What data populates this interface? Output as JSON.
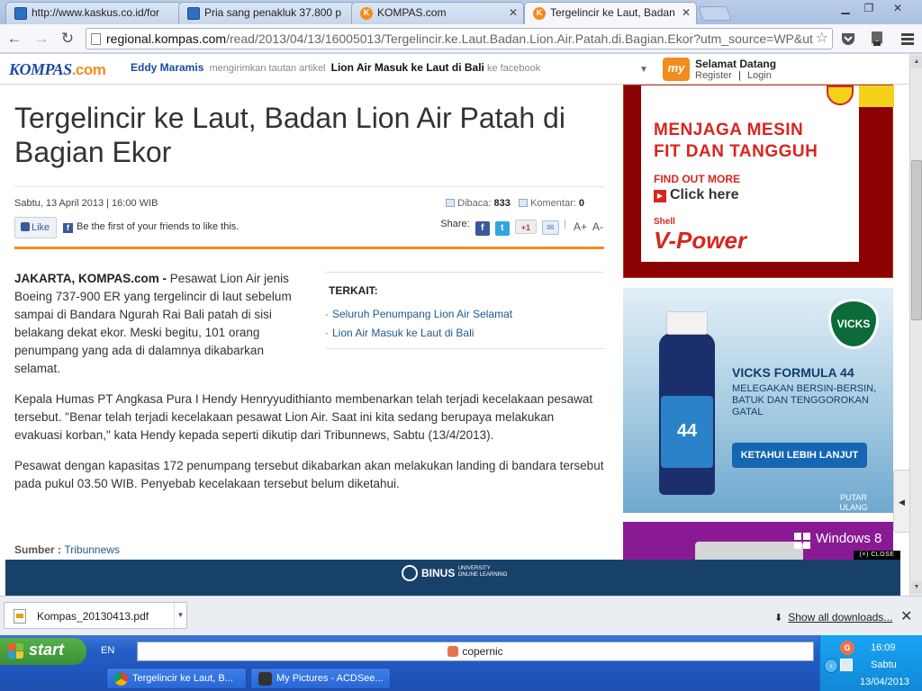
{
  "browser": {
    "tabs": [
      {
        "label": "http://www.kaskus.co.id/for",
        "favicon": "kaskus-favicon"
      },
      {
        "label": "Pria sang penakluk 37.800 p",
        "favicon": "kaskus-favicon"
      },
      {
        "label": "KOMPAS.com",
        "favicon": "kompas-favicon"
      },
      {
        "label": "Tergelincir ke Laut, Badan Lio",
        "favicon": "kompas-favicon"
      }
    ],
    "url_host": "regional.kompas.com",
    "url_path": "/read/2013/04/13/16005013/Tergelincir.ke.Laut.Badan.Lion.Air.Patah.di.Bagian.Ekor?utm_source=WP&ut",
    "accent": "#f28c1e"
  },
  "kompas_bar": {
    "logo": "KOMPAS",
    "logo_suffix": ".com",
    "share_user": "Eddy Maramis",
    "share_text": "mengirimkan tautan artikel",
    "share_article": "Lion Air Masuk ke Laut di Bali",
    "share_suffix": "ke facebook",
    "my_logo": "my",
    "welcome": "Selamat Datang",
    "register": "Register",
    "separator": "|",
    "login": "Login"
  },
  "article": {
    "headline": "Tergelincir ke Laut, Badan Lion Air Patah di Bagian Ekor",
    "date": "Sabtu, 13 April 2013 | 16:00 WIB",
    "dibaca_label": "Dibaca:",
    "dibaca_count": "833",
    "komentar_label": "Komentar:",
    "komentar_count": "0",
    "like_label": "Like",
    "fb_first": "Be the first of your friends to like this.",
    "share_label": "Share:",
    "share_gplus": "+1",
    "font_up": "A+",
    "font_down": "A-",
    "lead": "JAKARTA, KOMPAS.com -",
    "p1": " Pesawat Lion Air jenis Boeing 737-900 ER yang tergelincir di laut sebelum sampai di Bandara Ngurah Rai Bali patah di sisi belakang dekat ekor. Meski begitu, 101 orang penumpang yang ada di dalamnya dikabarkan selamat.",
    "p2": "Kepala Humas PT Angkasa Pura I Hendy Henryyudithianto membenarkan telah terjadi kecelakaan pesawat tersebut. \"Benar telah terjadi kecelakaan pesawat Lion Air. Saat ini kita sedang berupaya melakukan evakuasi korban,\" kata Hendy kepada seperti dikutip dari Tribunnews, Sabtu (13/4/2013).",
    "p3": "Pesawat dengan kapasitas 172 penumpang tersebut dikabarkan akan melakukan landing di bandara tersebut pada pukul 03.50 WIB. Penyebab kecelakaan tersebut belum diketahui.",
    "terkait_title": "TERKAIT:",
    "terkait_links": [
      "Seluruh Penumpang Lion Air Selamat",
      "Lion Air Masuk ke Laut di Bali"
    ],
    "sumber_label": "Sumber :",
    "sumber_value": "Tribunnews"
  },
  "ads": {
    "shell_line1": "MENJAGA MESIN",
    "shell_line2": "FIT DAN TANGGUH",
    "shell_find": "FIND OUT MORE",
    "shell_click": "Click here",
    "shell_brand": "Shell",
    "shell_product": "V-Power",
    "vicks_logo": "VICKS",
    "vicks_title": "VICKS FORMULA 44",
    "vicks_body": "MELEGAKAN BERSIN-BERSIN, BATUK DAN TENGGOROKAN GATAL",
    "vicks_bottle": "44",
    "vicks_button": "KETAHUI LEBIH LANJUT",
    "vicks_replay": "PUTAR ULANG",
    "windows_text": "Windows 8",
    "banner_close": "CLOSE",
    "binus": "BINUS",
    "binus_sub1": "UNIVERSITY",
    "binus_sub2": "ONLINE LEARNING"
  },
  "downloads": {
    "file": "Kompas_20130413.pdf",
    "show_all": "Show all downloads..."
  },
  "taskbar": {
    "start": "start",
    "lang": "EN",
    "search_text": "copernic",
    "buttons": [
      {
        "label": "Tergelincir ke Laut, B..."
      },
      {
        "label": "My Pictures - ACDSee..."
      }
    ],
    "time": "16:09",
    "day": "Sabtu",
    "date": "13/04/2013"
  }
}
